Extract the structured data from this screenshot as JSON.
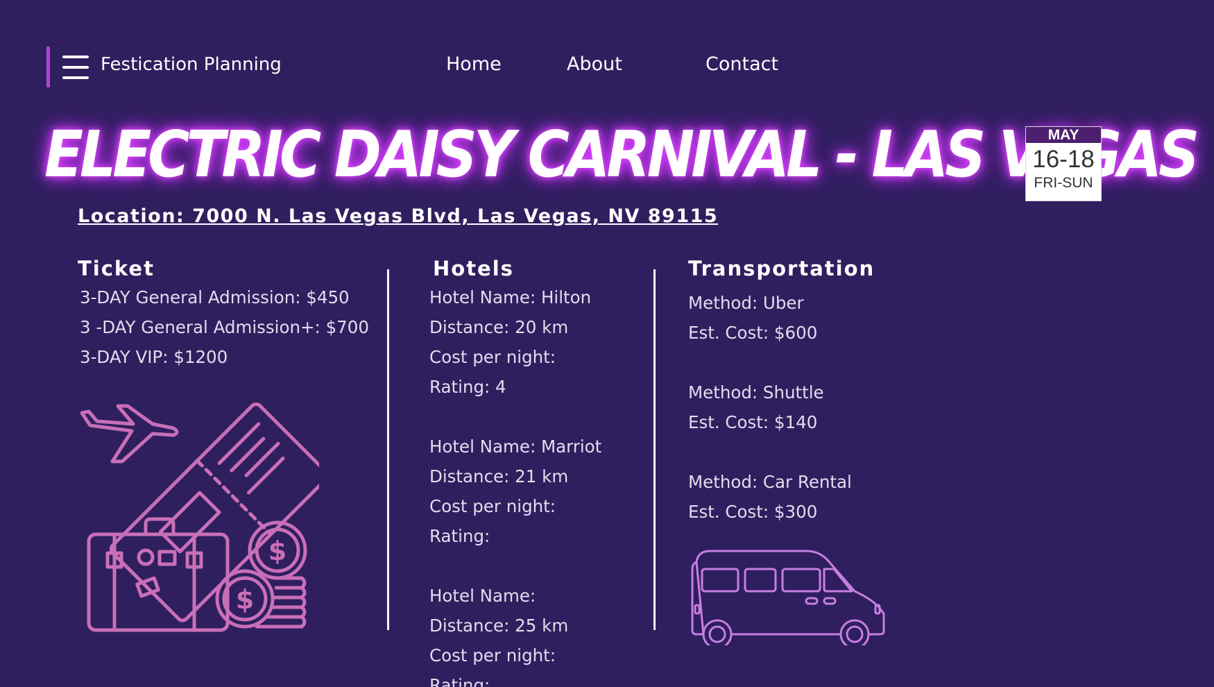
{
  "header": {
    "brand": "Festication Planning",
    "nav": [
      "Home",
      "About",
      "Contact"
    ]
  },
  "event": {
    "title": "ELECTRIC DAISY CARNIVAL - LAS VEGAS",
    "location": "Location: 7000 N. Las Vegas Blvd, Las Vegas, NV 89115",
    "date": {
      "month": "MAY",
      "days": "16-18",
      "weekdays": "FRI-SUN"
    }
  },
  "ticket": {
    "heading": "Ticket",
    "items": [
      "3-DAY General Admission: $450",
      "3 -DAY General Admission+: $700",
      "3-DAY VIP: $1200"
    ]
  },
  "hotels": {
    "heading": "Hotels",
    "lines": [
      "Hotel Name: Hilton",
      "Distance: 20 km",
      "Cost per night:",
      "Rating: 4",
      "",
      "Hotel Name: Marriot",
      "Distance: 21 km",
      "Cost per night:",
      "Rating:",
      "",
      "Hotel Name:",
      "Distance: 25 km",
      "Cost per night:",
      "Rating:"
    ]
  },
  "transportation": {
    "heading": "Transportation",
    "lines": [
      "Method: Uber",
      "Est. Cost: $600",
      "",
      "Method: Shuttle",
      "Est. Cost: $140",
      "",
      "Method: Car Rental",
      "Est. Cost: $300"
    ]
  },
  "icons": {
    "menu": "hamburger-menu-icon",
    "travel": "travel-ticket-suitcase-coins-icon",
    "van": "van-icon"
  },
  "colors": {
    "background": "#2f1f5e",
    "accent": "#b443d6",
    "glow": "#d13bff",
    "travel_icon": "#c96fb8",
    "van_icon": "#c77fe0",
    "badge_month_bg": "#4d1f6f"
  }
}
